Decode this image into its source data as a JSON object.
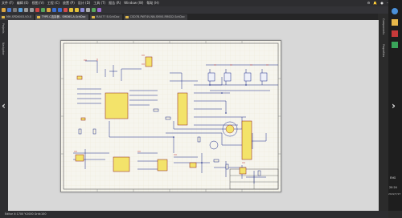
{
  "menubar": {
    "items": [
      "文件 (F)",
      "编辑 (E)",
      "视图 (V)",
      "工程 (C)",
      "放置 (P)",
      "设计 (D)",
      "工具 (T)",
      "报告 (R)",
      "Window (W)",
      "帮助 (H)"
    ]
  },
  "tabs": [
    {
      "label": "MH-SPD6003-V0.0",
      "active": false
    },
    {
      "label": "TYPE-C连接器 - SMD6S-A.SchDoc",
      "active": true
    },
    {
      "label": "MAX77 B.SchDoc",
      "active": false
    },
    {
      "label": "CSD7B-PWT4V-NN-SMV0-RR0D2.SchDoc",
      "active": false
    }
  ],
  "left_panel": {
    "tabs": [
      "Projects",
      "Navigator"
    ]
  },
  "right_panel": {
    "tabs": [
      "Components",
      "Properties"
    ]
  },
  "right_bar": {
    "lang": "ENG",
    "time": "20:24",
    "date": "2022/7/27"
  },
  "status": {
    "text": "Editor  X:1700 Y:2000  Grid:100"
  },
  "colors": {
    "sheet": "#f6f5ee",
    "component_fill": "#f3e36a",
    "wire": "#1a2a8a",
    "border": "#555555"
  }
}
